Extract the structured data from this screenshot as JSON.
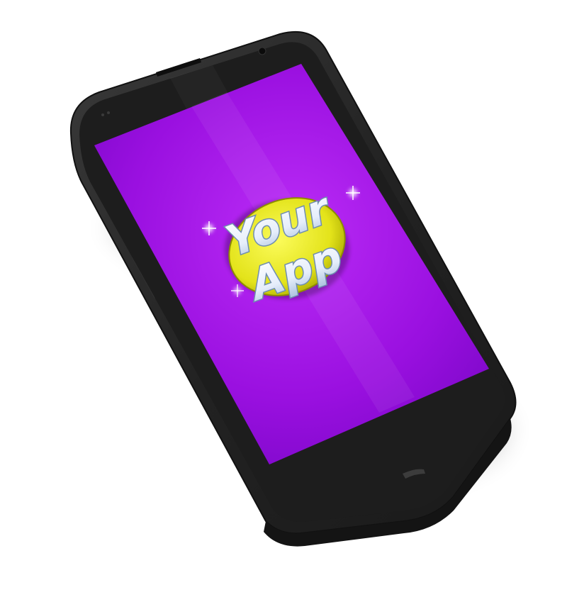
{
  "app_logo": {
    "line1": "Your",
    "line2": "App"
  },
  "colors": {
    "screen_purple": "#a512e8",
    "screen_purple_dark": "#7a06c4",
    "logo_badge_yellow": "#e8e81e",
    "logo_badge_yellow_dark": "#b3b300",
    "logo_text_fill": "#eef4ff",
    "logo_text_stroke": "#8aa6c4",
    "phone_body": "#2a2a2a",
    "phone_bezel": "#1b1b1b"
  },
  "icons": {
    "earpiece": "speaker-slot-icon",
    "camera": "front-camera-icon",
    "port": "usb-port-icon",
    "sensors": "proximity-sensor-icon"
  }
}
